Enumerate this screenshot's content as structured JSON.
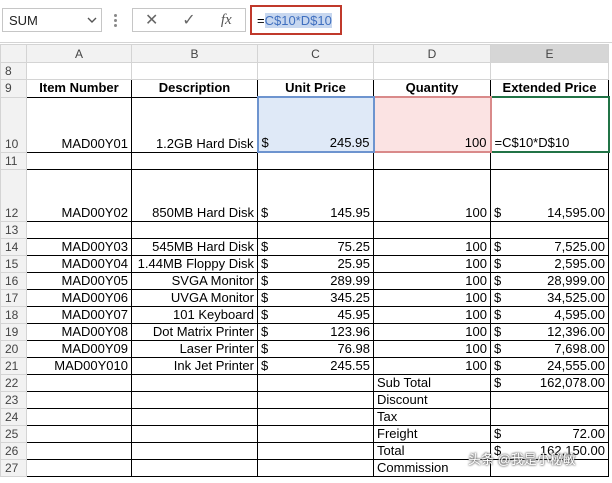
{
  "toolbar": {
    "name_box": "SUM",
    "cancel_icon": "✕",
    "enter_icon": "✓",
    "fx_label": "fx",
    "formula_prefix": "=",
    "formula_selected": "C$10*D$10"
  },
  "columns": [
    "A",
    "B",
    "C",
    "D",
    "E"
  ],
  "headers": {
    "a": "Item Number",
    "b": "Description",
    "c": "Unit Price",
    "d": "Quantity",
    "e": "Extended Price"
  },
  "rows": [
    {
      "num": "8"
    },
    {
      "num": "9"
    },
    {
      "num": "10",
      "item": "MAD00Y01",
      "desc": "1.2GB Hard Disk",
      "cur": "$",
      "price": "245.95",
      "qty": "100",
      "ext": "=C$10*D$10"
    },
    {
      "num": "11"
    },
    {
      "num": "12",
      "item": "MAD00Y02",
      "desc": "850MB Hard Disk",
      "cur": "$",
      "price": "145.95",
      "qty": "100",
      "ecur": "$",
      "ext": "14,595.00"
    },
    {
      "num": "13"
    },
    {
      "num": "14",
      "item": "MAD00Y03",
      "desc": "545MB Hard Disk",
      "cur": "$",
      "price": "75.25",
      "qty": "100",
      "ecur": "$",
      "ext": "7,525.00"
    },
    {
      "num": "15",
      "item": "MAD00Y04",
      "desc": "1.44MB Floppy Disk",
      "cur": "$",
      "price": "25.95",
      "qty": "100",
      "ecur": "$",
      "ext": "2,595.00"
    },
    {
      "num": "16",
      "item": "MAD00Y05",
      "desc": "SVGA Monitor",
      "cur": "$",
      "price": "289.99",
      "qty": "100",
      "ecur": "$",
      "ext": "28,999.00"
    },
    {
      "num": "17",
      "item": "MAD00Y06",
      "desc": "UVGA Monitor",
      "cur": "$",
      "price": "345.25",
      "qty": "100",
      "ecur": "$",
      "ext": "34,525.00"
    },
    {
      "num": "18",
      "item": "MAD00Y07",
      "desc": "101 Keyboard",
      "cur": "$",
      "price": "45.95",
      "qty": "100",
      "ecur": "$",
      "ext": "4,595.00"
    },
    {
      "num": "19",
      "item": "MAD00Y08",
      "desc": "Dot Matrix Printer",
      "cur": "$",
      "price": "123.96",
      "qty": "100",
      "ecur": "$",
      "ext": "12,396.00"
    },
    {
      "num": "20",
      "item": "MAD00Y09",
      "desc": "Laser Printer",
      "cur": "$",
      "price": "76.98",
      "qty": "100",
      "ecur": "$",
      "ext": "7,698.00"
    },
    {
      "num": "21",
      "item": "MAD00Y010",
      "desc": "Ink Jet Printer",
      "cur": "$",
      "price": "245.55",
      "qty": "100",
      "ecur": "$",
      "ext": "24,555.00"
    }
  ],
  "summary": [
    {
      "num": "22",
      "label": "Sub Total",
      "ecur": "$",
      "ext": "162,078.00"
    },
    {
      "num": "23",
      "label": "Discount",
      "ecur": "",
      "ext": ""
    },
    {
      "num": "24",
      "label": "Tax",
      "ecur": "",
      "ext": ""
    },
    {
      "num": "25",
      "label": "Freight",
      "ecur": "$",
      "ext": "72.00"
    },
    {
      "num": "26",
      "label": "Total",
      "ecur": "$",
      "ext": "162,150.00"
    },
    {
      "num": "27",
      "label": "Commission",
      "ecur": "",
      "ext": ""
    }
  ],
  "watermark": "头条 @我是小秘敏",
  "colors": {
    "accent": "#217346",
    "formula_border": "#c0392b",
    "c_ref": "#6d94cf",
    "d_ref": "#d98a8a"
  }
}
